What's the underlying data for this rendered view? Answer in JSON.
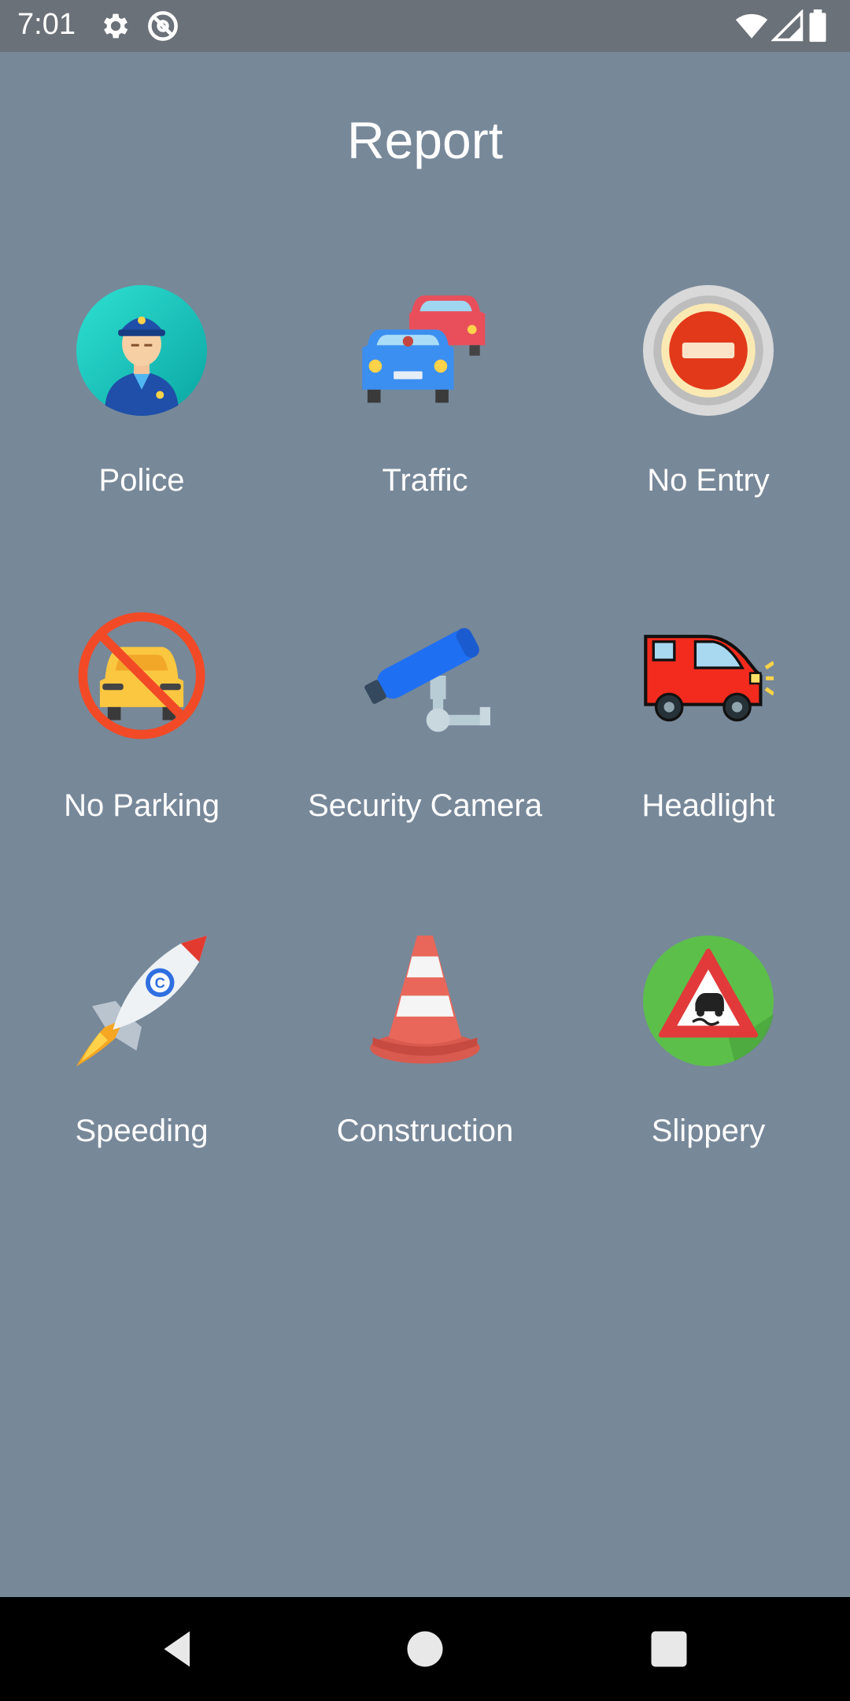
{
  "status_bar": {
    "time": "7:01",
    "icons": [
      "gear-icon",
      "at-sign-icon",
      "wifi-icon",
      "signal-icon",
      "battery-icon"
    ]
  },
  "screen": {
    "title": "Report",
    "background": "#778899"
  },
  "report_items": [
    {
      "label": "Police",
      "icon": "police-officer-icon"
    },
    {
      "label": "Traffic",
      "icon": "traffic-cars-icon"
    },
    {
      "label": "No Entry",
      "icon": "no-entry-sign-icon"
    },
    {
      "label": "No Parking",
      "icon": "no-parking-car-icon"
    },
    {
      "label": "Security Camera",
      "icon": "security-camera-icon"
    },
    {
      "label": "Headlight",
      "icon": "headlight-car-icon"
    },
    {
      "label": "Speeding",
      "icon": "rocket-icon"
    },
    {
      "label": "Construction",
      "icon": "traffic-cone-icon"
    },
    {
      "label": "Slippery",
      "icon": "slippery-road-sign-icon"
    }
  ],
  "nav_bar": {
    "buttons": [
      "back-icon",
      "home-icon",
      "recents-icon"
    ]
  }
}
